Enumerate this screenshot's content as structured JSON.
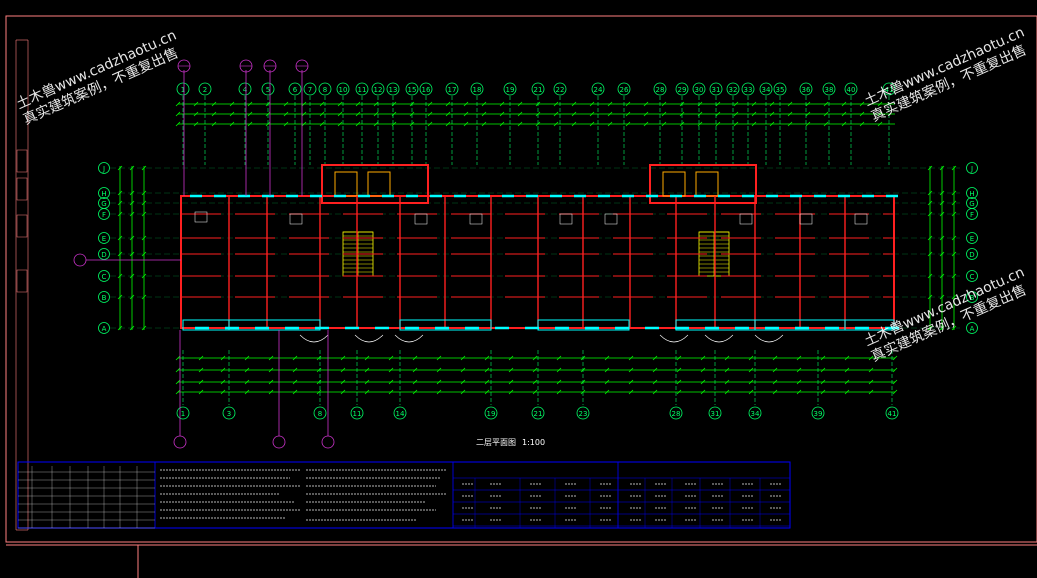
{
  "watermark": {
    "line1": "土木兽www.cadzhaotu.cn",
    "line2": "真实建筑案例，不重复出售"
  },
  "drawing": {
    "title": "二层平面图",
    "scale": "1:100"
  },
  "axes": {
    "top_columns": [
      "1",
      "2",
      "4",
      "5",
      "6",
      "7",
      "8",
      "10",
      "11",
      "12",
      "13",
      "15",
      "16",
      "17",
      "18",
      "19",
      "21",
      "22",
      "24",
      "26",
      "28",
      "29",
      "30",
      "31",
      "32",
      "33",
      "34",
      "35",
      "36",
      "38",
      "40",
      "41"
    ],
    "bottom_columns": [
      "1",
      "3",
      "8",
      "11",
      "14",
      "19",
      "21",
      "23",
      "28",
      "31",
      "34",
      "39",
      "41"
    ],
    "rows": [
      "A",
      "B",
      "C",
      "D",
      "E",
      "F",
      "G",
      "H",
      "J"
    ]
  },
  "colors": {
    "background": "#000000",
    "walls": "#ff2020",
    "dimensions": "#00ff00",
    "windows": "#00ffff",
    "axes": "#00ff66",
    "callouts": "#cc33cc",
    "stairs": "#ffff00",
    "table": "#0000ff",
    "frame": "#ff8080"
  }
}
